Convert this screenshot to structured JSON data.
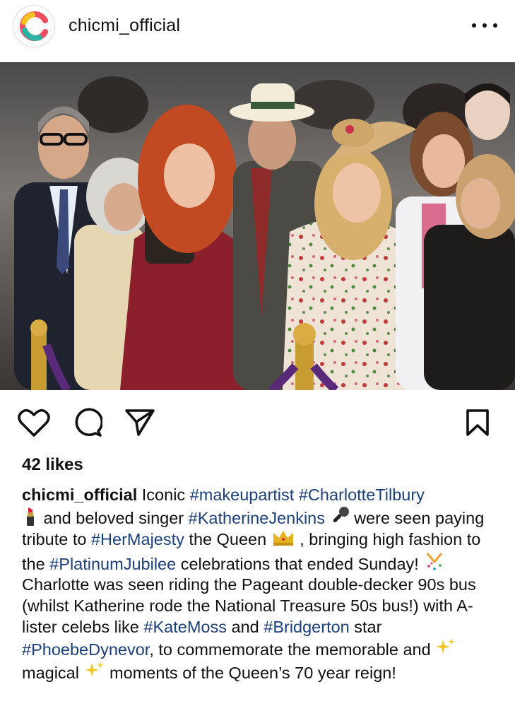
{
  "header": {
    "username": "chicmi_official",
    "avatar_icon": "chicmi-logo-icon",
    "more_icon": "ellipsis-icon"
  },
  "post": {
    "image_alt": "Group photo of guests at the Platinum Jubilee celebrations",
    "actions": {
      "like_icon": "heart-icon",
      "comment_icon": "comment-bubble-icon",
      "share_icon": "paper-plane-icon",
      "save_icon": "bookmark-icon"
    },
    "likes": "42 likes",
    "caption": {
      "username": "chicmi_official",
      "parts": [
        " Iconic ",
        "#makeupartist",
        " ",
        "#CharlotteTilbury",
        " and beloved singer ",
        "#KatherineJenkins",
        " were seen paying tribute to ",
        "#HerMajesty",
        " the Queen ",
        " , bringing high fashion to the ",
        "#PlatinumJubilee",
        " celebrations that ended Sunday! ",
        "  Charlotte was seen riding the Pageant double-decker 90s bus (whilst Katherine rode the National Treasure 50s bus!) with A-lister celebs like ",
        "#KateMoss",
        " and ",
        "#Bridgerton",
        " star ",
        "#PhoebeDynevor",
        ", to commemorate the memorable and ",
        "magical ",
        "  moments of the Queen’s 70 year reign!"
      ],
      "emojis": {
        "lipstick": "lipstick-emoji",
        "microphone": "microphone-emoji",
        "crown": "crown-emoji",
        "confetti": "confetti-emoji",
        "sparkles": "sparkles-emoji"
      }
    }
  },
  "colors": {
    "hashtag": "#1b3f7a",
    "text": "#111111"
  }
}
